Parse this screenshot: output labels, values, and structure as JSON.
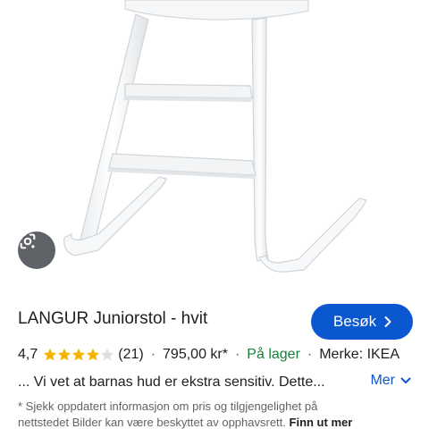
{
  "product": {
    "title": "LANGUR Juniorstol - hvit",
    "rating": "4,7",
    "rating_value": 4.7,
    "reviews": "(21)",
    "separator": "·",
    "price": "795,00 kr*",
    "stock_status": "På lager",
    "brand": "Merke: IKEA",
    "description": "... Vi vet at barnas hud er ekstra sensitiv. Dette..."
  },
  "actions": {
    "visit_label": "Besøk",
    "more_label": "Mer"
  },
  "disclaimer": {
    "line1": "* Sjekk oppdatert informasjon om pris og tilgjengelighet på",
    "line2_prefix": "nettstedet Bilder kan være beskyttet av opphavsrett.",
    "link": "Finn ut mer"
  },
  "icons": {
    "lens": "google-lens-icon",
    "star": "star-icon",
    "chevron_right": "chevron-right-icon",
    "chevron_down": "chevron-down-icon"
  },
  "colors": {
    "accent": "#0b57d0",
    "star": "#f4b400",
    "stock": "#188038",
    "lens_bg": "#5f6368"
  }
}
